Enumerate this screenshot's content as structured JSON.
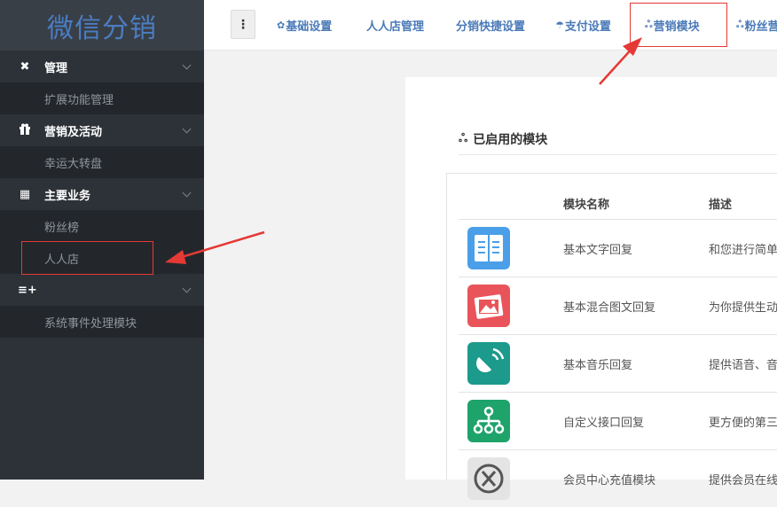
{
  "sidebar": {
    "logo": "微信分销",
    "groups": [
      {
        "icon": "tools-icon",
        "glyph": "✖",
        "label": "管理",
        "items": [
          "扩展功能管理"
        ]
      },
      {
        "icon": "gift-icon",
        "glyph": "🎁",
        "label": "营销及活动",
        "items": [
          "幸运大转盘"
        ]
      },
      {
        "icon": "grid-icon",
        "glyph": "▦",
        "label": "主要业务",
        "items": [
          "粉丝榜",
          "人人店"
        ]
      },
      {
        "icon": "list-plus-icon",
        "glyph": "≡+",
        "label": "",
        "items": [
          "系统事件处理模块"
        ]
      }
    ]
  },
  "topnav": {
    "menu_glyph": "⋮",
    "tabs": [
      {
        "label": "基础设置",
        "glyph": "✿"
      },
      {
        "label": "人人店管理",
        "glyph": ""
      },
      {
        "label": "分销快捷设置",
        "glyph": ""
      },
      {
        "label": "支付设置",
        "glyph": "☂"
      },
      {
        "label": "营销模块",
        "glyph": "ஃ"
      },
      {
        "label": "粉丝营",
        "glyph": "ஃ"
      }
    ]
  },
  "main": {
    "panel_title": "已启用的模块",
    "panel_glyph": "ஃ",
    "columns": [
      "模块名称",
      "描述"
    ],
    "rows": [
      {
        "name": "基本文字回复",
        "desc": "和您进行简单",
        "icon": "text-reply-icon",
        "color": "#4a9fe8"
      },
      {
        "name": "基本混合图文回复",
        "desc": "为你提供生动",
        "icon": "news-reply-icon",
        "color": "#e9545a"
      },
      {
        "name": "基本音乐回复",
        "desc": "提供语音、音",
        "icon": "music-reply-icon",
        "color": "#1c9a8c"
      },
      {
        "name": "自定义接口回复",
        "desc": "更方便的第三",
        "icon": "api-reply-icon",
        "color": "#1ea36b"
      },
      {
        "name": "会员中心充值模块",
        "desc": "提供会员在线",
        "icon": "recharge-icon",
        "color": "#e4e4e4"
      }
    ]
  },
  "colors": {
    "highlight": "#e53935",
    "accent": "#4a7ab8",
    "sidebar": "#2d3238"
  }
}
